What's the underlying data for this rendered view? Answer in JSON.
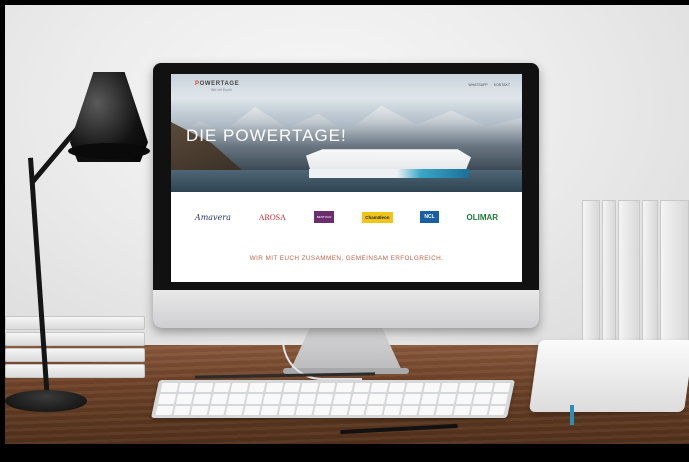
{
  "website": {
    "brand_prefix": "P",
    "brand_rest": "OWERTAGE",
    "brand_tagline": "Wir mit Euch!",
    "nav": [
      "WHATSAPP",
      "KONTAKT"
    ],
    "hero_title": "DIE POWERTAGE!",
    "partner_logos": [
      "Amavera",
      "AROSA",
      "BENTOUR",
      "Chamäleon",
      "NCL",
      "OLIMAR"
    ],
    "motto": "WIR MIT EUCH ZUSAMMEN, GEMEINSAM ERFOLGREICH."
  },
  "colors": {
    "accent": "#d94c3a",
    "motto_color": "#c0664d",
    "desk": "#6b412a"
  }
}
